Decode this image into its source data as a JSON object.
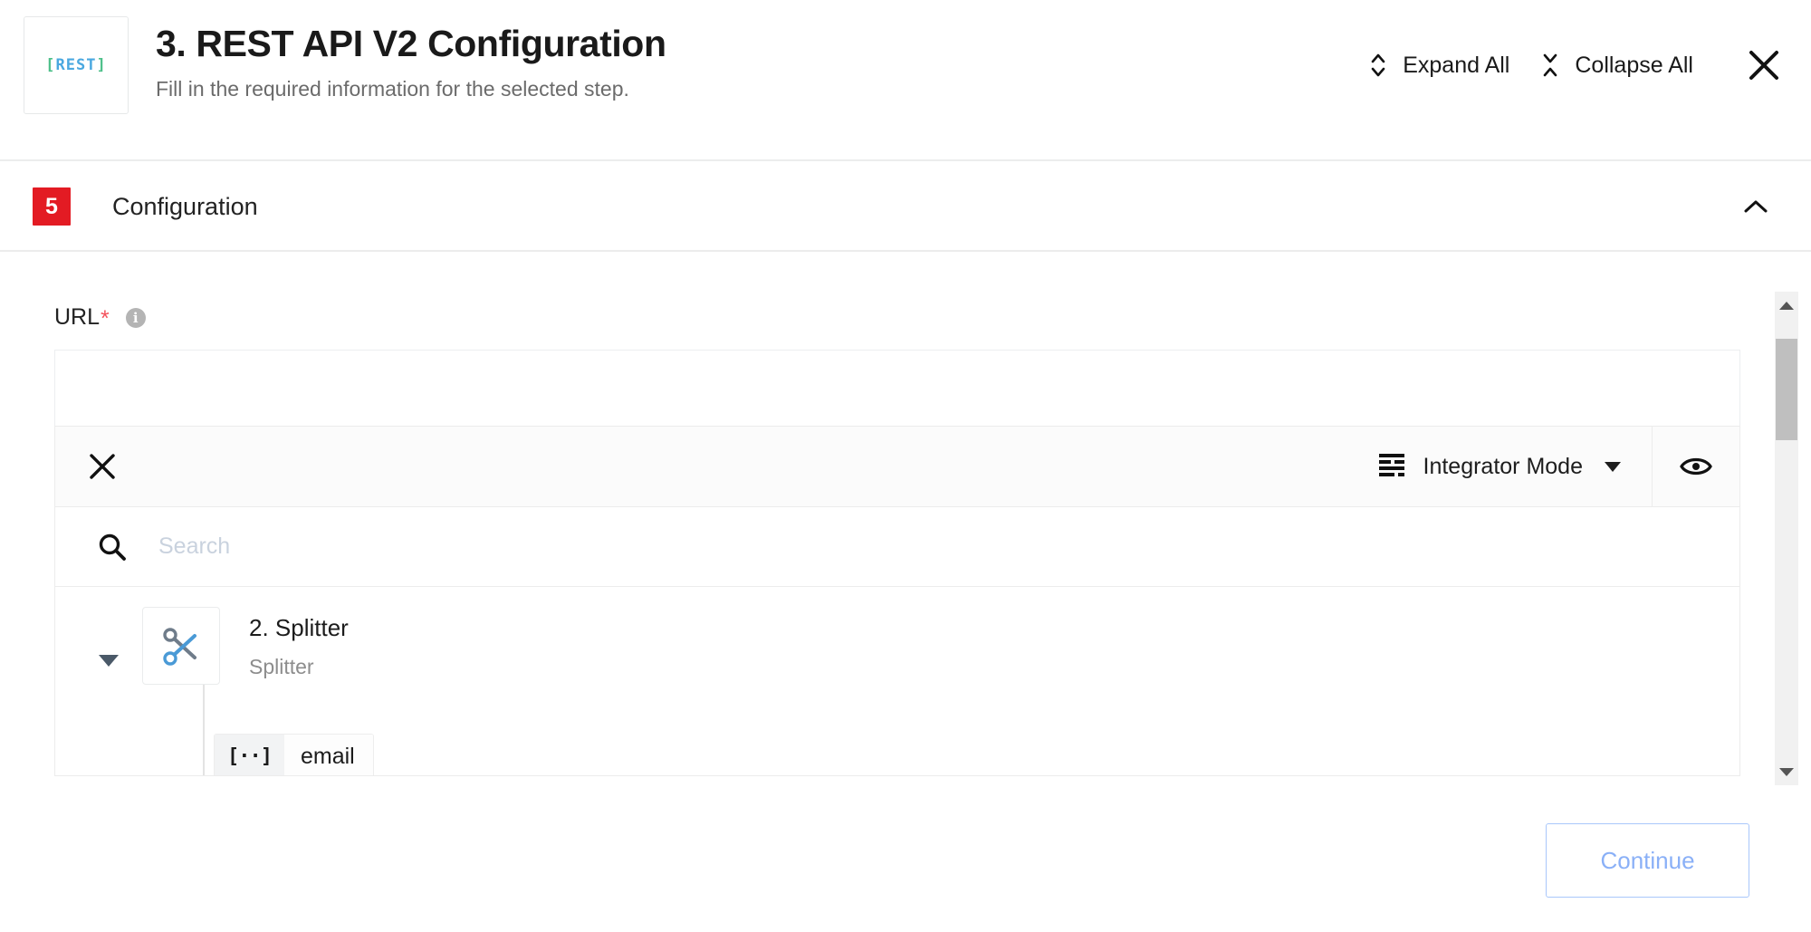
{
  "header": {
    "logo": {
      "bracket_left": "[",
      "word": "REST",
      "bracket_right": "]"
    },
    "title": "3. REST API V2 Configuration",
    "subtitle": "Fill in the required information for the selected step.",
    "expand_all_label": "Expand All",
    "collapse_all_label": "Collapse All",
    "close_label": "✕"
  },
  "section": {
    "badge": "5",
    "title": "Configuration"
  },
  "form": {
    "url_label": "URL",
    "required_marker": "*",
    "info_glyph": "i",
    "url_value": "",
    "url_placeholder": ""
  },
  "picker": {
    "close_label": "✕",
    "mode_label": "Integrator Mode",
    "search_placeholder": "Search",
    "search_value": "",
    "tree": [
      {
        "title": "2. Splitter",
        "subtitle": "Splitter",
        "icon": "scissors-icon",
        "expanded": true,
        "chips": [
          {
            "icon_text": "[··]",
            "label": "email"
          }
        ]
      }
    ]
  },
  "footer": {
    "continue_label": "Continue"
  },
  "colors": {
    "badge_red": "#e31b23",
    "required_red": "#f4525c",
    "continue_border": "#a9c7fb",
    "continue_text": "#8ab0f7",
    "logo_bracket": "#4ec08a",
    "logo_word": "#4aa8e0"
  }
}
